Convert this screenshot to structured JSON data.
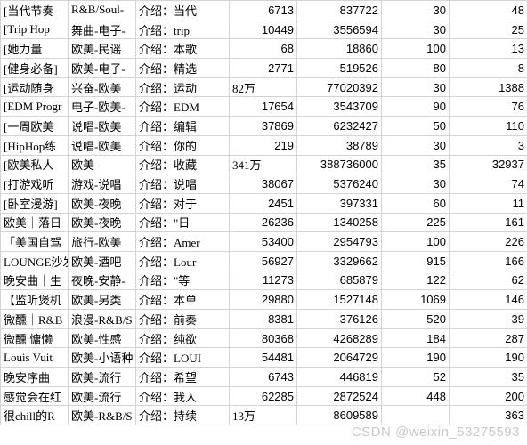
{
  "watermark": "CSDN @weixin_53275593",
  "rows": [
    {
      "c1": "[当代节奏",
      "c2": "R&B/Soul-",
      "c3": "介绍：当代",
      "c4": "6713",
      "c5": "837722",
      "c6": "30",
      "c7": "48"
    },
    {
      "c1": "[Trip Hop",
      "c2": "舞曲-电子-",
      "c3": "介绍：trip",
      "c4": "10449",
      "c5": "3556594",
      "c6": "30",
      "c7": "25"
    },
    {
      "c1": "[她力量",
      "c2": "欧美-民谣",
      "c3": "介绍：本歌",
      "c4": "68",
      "c5": "18860",
      "c6": "100",
      "c7": "13"
    },
    {
      "c1": "[健身必备]",
      "c2": "欧美-电子-",
      "c3": "介绍：精选",
      "c4": "2771",
      "c5": "519526",
      "c6": "80",
      "c7": "8"
    },
    {
      "c1": "[运动随身",
      "c2": "兴奋-欧美",
      "c3": "介绍：运动",
      "c4": "82万",
      "c5": "77020392",
      "c6": "30",
      "c7": "1388"
    },
    {
      "c1": "[EDM Progr",
      "c2": "电子-欧美-",
      "c3": "介绍：EDM",
      "c4": "17654",
      "c5": "3543709",
      "c6": "90",
      "c7": "76"
    },
    {
      "c1": "[一周欧美",
      "c2": "说唱-欧美",
      "c3": "介绍：编辑",
      "c4": "37869",
      "c5": "6232427",
      "c6": "50",
      "c7": "110"
    },
    {
      "c1": "[HipHop练",
      "c2": "说唱-欧美",
      "c3": "介绍：你的",
      "c4": "219",
      "c5": "38789",
      "c6": "30",
      "c7": "3"
    },
    {
      "c1": "[欧美私人",
      "c2": "欧美",
      "c3": "介绍：收藏",
      "c4": "341万",
      "c5": "388736000",
      "c6": "35",
      "c7": "32937"
    },
    {
      "c1": "[打游戏听",
      "c2": "游戏-说唱",
      "c3": "介绍：说唱",
      "c4": "38067",
      "c5": "5376240",
      "c6": "30",
      "c7": "74"
    },
    {
      "c1": "[卧室漫游]",
      "c2": "欧美-夜晚",
      "c3": "介绍：对于",
      "c4": "2451",
      "c5": "397331",
      "c6": "60",
      "c7": "11"
    },
    {
      "c1": "欧美｜落日",
      "c2": "欧美-夜晚",
      "c3": "介绍：\"日",
      "c4": "26236",
      "c5": "1340258",
      "c6": "225",
      "c7": "161"
    },
    {
      "c1": "「美国自驾",
      "c2": "旅行-欧美",
      "c3": "介绍：Amer",
      "c4": "53400",
      "c5": "2954793",
      "c6": "100",
      "c7": "226"
    },
    {
      "c1": "LOUNGE沙发",
      "c2": "欧美-酒吧",
      "c3": "介绍：Lour",
      "c4": "56927",
      "c5": "3329662",
      "c6": "915",
      "c7": "166"
    },
    {
      "c1": "晚安曲｜生",
      "c2": "夜晚-安静-",
      "c3": "介绍：\"等",
      "c4": "11273",
      "c5": "685879",
      "c6": "122",
      "c7": "62"
    },
    {
      "c1": "【监听煲机",
      "c2": "欧美-另类",
      "c3": "介绍：本单",
      "c4": "29880",
      "c5": "1527148",
      "c6": "1069",
      "c7": "146"
    },
    {
      "c1": "微醺｜R&B",
      "c2": "浪漫-R&B/S",
      "c3": "介绍：前奏",
      "c4": "8381",
      "c5": "376126",
      "c6": "520",
      "c7": "39"
    },
    {
      "c1": "微醺 慵懒",
      "c2": "欧美-性感",
      "c3": "介绍：纯欲",
      "c4": "80368",
      "c5": "4268289",
      "c6": "184",
      "c7": "287"
    },
    {
      "c1": "Louis Vuit",
      "c2": "欧美-小语种",
      "c3": "介绍：LOUI",
      "c4": "54481",
      "c5": "2064729",
      "c6": "190",
      "c7": "190"
    },
    {
      "c1": "晚安序曲",
      "c2": "欧美-流行",
      "c3": "介绍：希望",
      "c4": "6743",
      "c5": "446819",
      "c6": "52",
      "c7": "35"
    },
    {
      "c1": "感觉会在红",
      "c2": "欧美-流行",
      "c3": "介绍：我人",
      "c4": "62285",
      "c5": "2872524",
      "c6": "448",
      "c7": "200"
    },
    {
      "c1": "很chill的R",
      "c2": "欧美-R&B/S",
      "c3": "介绍：持续",
      "c4": "13万",
      "c5": "8609589",
      "c6": "",
      "c7": "363"
    }
  ],
  "chart_data": {
    "type": "table",
    "title": "",
    "columns": [
      "col1",
      "col2",
      "col3",
      "col4",
      "col5",
      "col6",
      "col7"
    ],
    "rows": [
      [
        "[当代节奏",
        "R&B/Soul-",
        "介绍：当代",
        6713,
        837722,
        30,
        48
      ],
      [
        "[Trip Hop",
        "舞曲-电子-",
        "介绍：trip",
        10449,
        3556594,
        30,
        25
      ],
      [
        "[她力量",
        "欧美-民谣",
        "介绍：本歌",
        68,
        18860,
        100,
        13
      ],
      [
        "[健身必备]",
        "欧美-电子-",
        "介绍：精选",
        2771,
        519526,
        80,
        8
      ],
      [
        "[运动随身",
        "兴奋-欧美",
        "介绍：运动",
        "82万",
        77020392,
        30,
        1388
      ],
      [
        "[EDM Progr",
        "电子-欧美-",
        "介绍：EDM",
        17654,
        3543709,
        90,
        76
      ],
      [
        "[一周欧美",
        "说唱-欧美",
        "介绍：编辑",
        37869,
        6232427,
        50,
        110
      ],
      [
        "[HipHop练",
        "说唱-欧美",
        "介绍：你的",
        219,
        38789,
        30,
        3
      ],
      [
        "[欧美私人",
        "欧美",
        "介绍：收藏",
        "341万",
        388736000,
        35,
        32937
      ],
      [
        "[打游戏听",
        "游戏-说唱",
        "介绍：说唱",
        38067,
        5376240,
        30,
        74
      ],
      [
        "[卧室漫游]",
        "欧美-夜晚",
        "介绍：对于",
        2451,
        397331,
        60,
        11
      ],
      [
        "欧美｜落日",
        "欧美-夜晚",
        "介绍：\"日",
        26236,
        1340258,
        225,
        161
      ],
      [
        "「美国自驾",
        "旅行-欧美",
        "介绍：Amer",
        53400,
        2954793,
        100,
        226
      ],
      [
        "LOUNGE沙发",
        "欧美-酒吧",
        "介绍：Lour",
        56927,
        3329662,
        915,
        166
      ],
      [
        "晚安曲｜生",
        "夜晚-安静-",
        "介绍：\"等",
        11273,
        685879,
        122,
        62
      ],
      [
        "【监听煲机",
        "欧美-另类",
        "介绍：本单",
        29880,
        1527148,
        1069,
        146
      ],
      [
        "微醺｜R&B",
        "浪漫-R&B/S",
        "介绍：前奏",
        8381,
        376126,
        520,
        39
      ],
      [
        "微醺 慵懒",
        "欧美-性感",
        "介绍：纯欲",
        80368,
        4268289,
        184,
        287
      ],
      [
        "Louis Vuit",
        "欧美-小语种",
        "介绍：LOUI",
        54481,
        2064729,
        190,
        190
      ],
      [
        "晚安序曲",
        "欧美-流行",
        "介绍：希望",
        6743,
        446819,
        52,
        35
      ],
      [
        "感觉会在红",
        "欧美-流行",
        "介绍：我人",
        62285,
        2872524,
        448,
        200
      ],
      [
        "很chill的R",
        "欧美-R&B/S",
        "介绍：持续",
        "13万",
        8609589,
        null,
        363
      ]
    ]
  }
}
